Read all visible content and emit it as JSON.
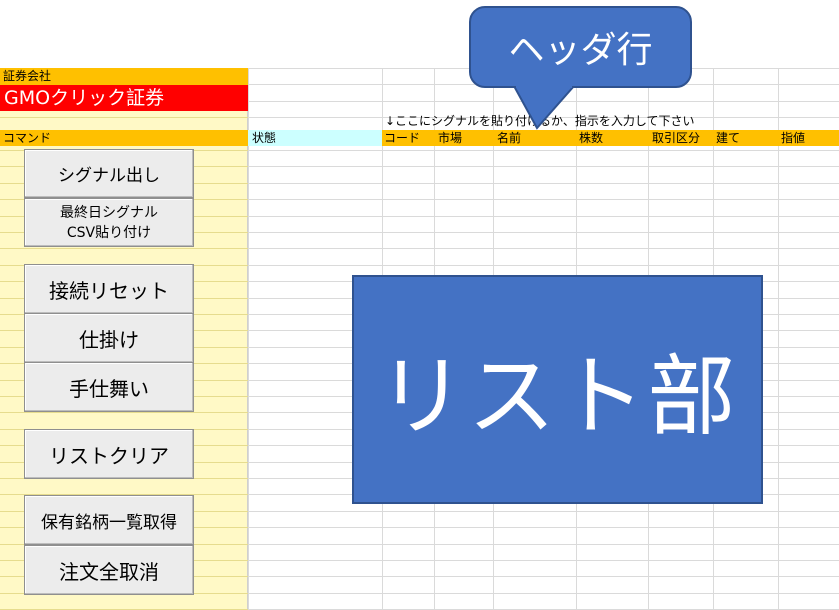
{
  "sheet": {
    "broker_label": "証券会社",
    "broker_name": "GMOクリック証券",
    "command_label": "コマンド",
    "status_label": "状態",
    "instruction": "↓ここにシグナルを貼り付けるか、指示を入力して下さい",
    "columns": [
      "コード",
      "市場",
      "名前",
      "株数",
      "取引区分",
      "建て",
      "指値"
    ]
  },
  "buttons": {
    "signal_out": "シグナル出し",
    "last_day_line1": "最終日シグナル",
    "last_day_line2": "CSV貼り付け",
    "reset_connection": "接続リセット",
    "place_order": "仕掛け",
    "close_position": "手仕舞い",
    "clear_list": "リストクリア",
    "get_holdings": "保有銘柄一覧取得",
    "cancel_all": "注文全取消"
  },
  "annotations": {
    "header_callout": "ヘッダ行",
    "list_area": "リスト部"
  },
  "colors": {
    "accent_blue": "#4472c4",
    "header_orange": "#ffc000",
    "broker_red": "#ff0000",
    "panel_yellow": "#fff9c6",
    "status_cyan": "#ccffff"
  }
}
